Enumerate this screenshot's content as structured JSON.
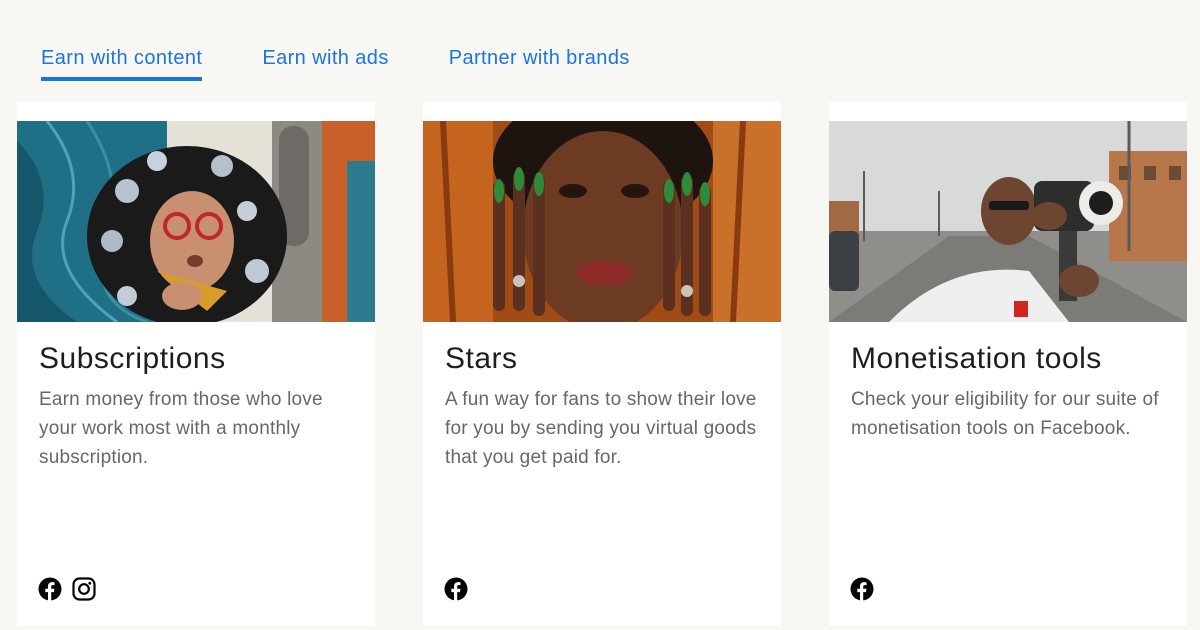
{
  "tabs": [
    {
      "label": "Earn with content",
      "active": true
    },
    {
      "label": "Earn with ads",
      "active": false
    },
    {
      "label": "Partner with brands",
      "active": false
    }
  ],
  "cards": [
    {
      "title": "Subscriptions",
      "description": "Earn money from those who love your work most with a monthly subscription.",
      "image": "person-with-flower-wig-photo",
      "platforms": [
        "facebook-icon",
        "instagram-icon"
      ]
    },
    {
      "title": "Stars",
      "description": "A fun way for fans to show their love for you by sending you virtual goods that you get paid for.",
      "image": "woman-with-decorated-nails-photo",
      "platforms": [
        "facebook-icon"
      ]
    },
    {
      "title": "Monetisation tools",
      "description": "Check your eligibility for our suite of monetisation tools on Facebook.",
      "image": "man-filming-with-camera-photo",
      "platforms": [
        "facebook-icon"
      ]
    }
  ],
  "colors": {
    "accent": "#1b74e4",
    "background": "#f8f7f4",
    "card": "#ffffff",
    "title_text": "#1c1e21",
    "body_text": "#65676b"
  }
}
